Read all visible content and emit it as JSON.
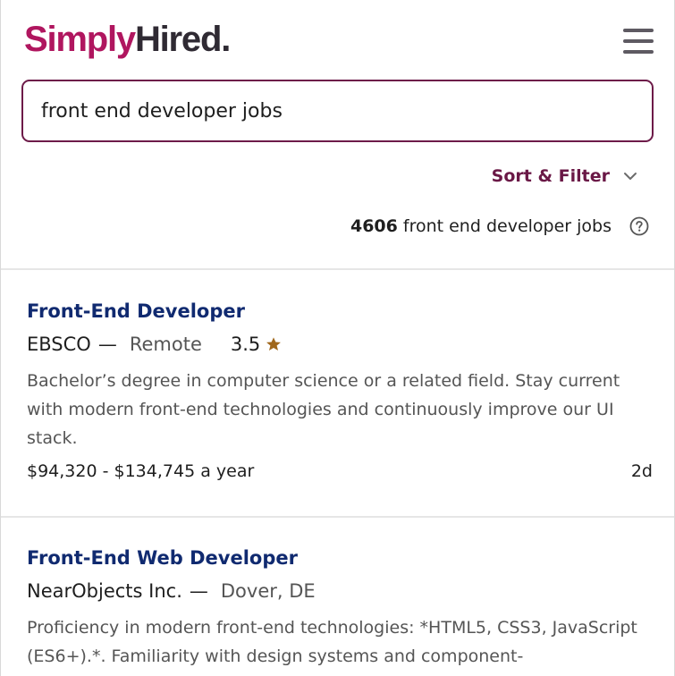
{
  "header": {
    "logo_part1": "Simply",
    "logo_part2": "Hired.",
    "menu_icon": "hamburger-menu-icon"
  },
  "search": {
    "value": "front end developer jobs"
  },
  "sort_filter": {
    "label": "Sort & Filter",
    "icon": "chevron-down-icon"
  },
  "results": {
    "count": "4606",
    "text": "front end developer jobs",
    "help_icon": "question-circle-icon"
  },
  "colors": {
    "brand": "#b0165f",
    "brand_dark": "#2f2a33",
    "accent": "#6d1b49",
    "job_title": "#102a70",
    "star": "#a0671b"
  },
  "jobs": [
    {
      "title": "Front-End Developer",
      "company": "EBSCO",
      "dash": "—",
      "location": "Remote",
      "rating": "3.5",
      "description": "Bachelor’s degree in computer science or a related field. Stay current with modern front-end technologies and continuously improve our UI stack.",
      "salary": "$94,320 - $134,745 a year",
      "age": "2d"
    },
    {
      "title": "Front-End Web Developer",
      "company": "NearObjects Inc.",
      "dash": "—",
      "location": "Dover, DE",
      "description": "Proficiency in modern front-end technologies: *HTML5, CSS3, JavaScript (ES6+).*. Familiarity with design systems and component-"
    }
  ]
}
